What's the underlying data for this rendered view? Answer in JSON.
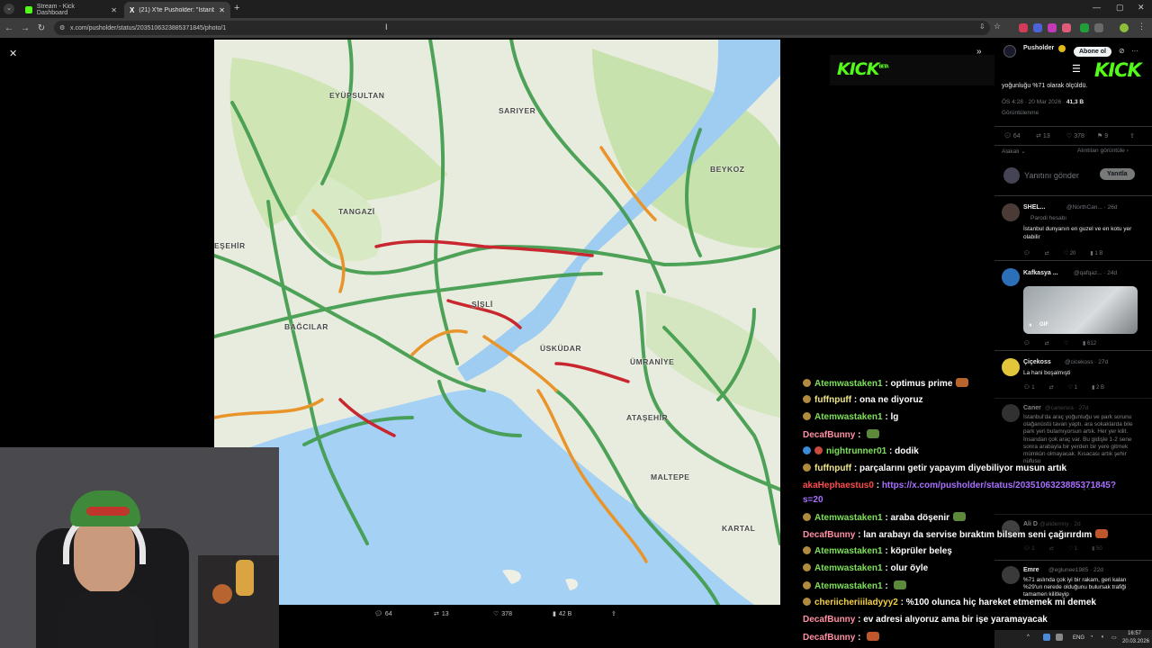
{
  "browser": {
    "tabs": [
      {
        "title": "Stream - Kick Dashboard",
        "active": false
      },
      {
        "title": "(21) X'te Pusholder: \"İstanbul'd",
        "active": true
      }
    ],
    "url": "x.com/pusholder/status/2035106323885371845/photo/1"
  },
  "map": {
    "places": [
      "EYÜPSULTAN",
      "SARIYER",
      "BEYKOZ",
      "TANGAZİ",
      "EŞEHİR",
      "BAĞCILAR",
      "ŞİŞLİ",
      "ÜSKÜDAR",
      "ÜMRANİYE",
      "ATAŞEHİR",
      "MALTEPE",
      "KARTAL"
    ]
  },
  "tweet_actions": {
    "replies": "64",
    "reposts": "13",
    "likes": "378",
    "views": "42 B"
  },
  "xpanel": {
    "author": "Pusholder",
    "follow_label": "Abone ol",
    "tweet_tail": "yoğunluğu %71 olarak ölçüldü.",
    "meta_time": "ÖS 4:28 · 20 Mar 2026 · ",
    "meta_views": "41,3 B",
    "meta_views_label": "Görüntülenme",
    "stats": {
      "replies": "64",
      "reposts": "13",
      "likes": "378",
      "bookmarks": "9"
    },
    "sort_label": "Alakalı",
    "quotes_label": "Alıntıları görüntüle",
    "reply_placeholder": "Yanıtını gönder",
    "reply_button": "Yanıtla",
    "replies": [
      {
        "name": "SHEL...",
        "handle": "@NorthCan... · 26d",
        "sub": "Parodi hesabı",
        "text": "İstanbul dunyanın en guzel ve en kotu yer olabilir",
        "stats": [
          "",
          "",
          "20",
          "1 B"
        ]
      },
      {
        "name": "Kafkasya ...",
        "handle": "@qafqaz... · 24d",
        "sub": "",
        "text": "",
        "gif": "GIF",
        "stats": [
          "",
          "",
          "",
          "612"
        ]
      },
      {
        "name": "Çiçekoss",
        "handle": "@cicekoss · 27d",
        "sub": "",
        "text": "La hani boşalmışti",
        "stats": [
          "1",
          "",
          "1",
          "2 B"
        ]
      },
      {
        "name": "Caner",
        "handle": "@canersra · 27d",
        "sub": "",
        "text": "İstanbul'da araç yoğunluğu ve park sorunu olağanüstü tavan yaptı. ara sokaklarda bile park yeri bulamıyorsun artık. Her yer kilit. İnsandan çok araç var. Bu gidişle 1-2 sene sonra arabayla bir yerden bir yere gitmek mümkün olmayacak. Kısacası artık şehir nüfusu",
        "stats": [
          "",
          "",
          "",
          "1 B"
        ]
      },
      {
        "name": "Ali D",
        "handle": "@alidemny · 2d",
        "sub": "",
        "text": "",
        "stats": [
          "1",
          "",
          "1",
          "50"
        ]
      },
      {
        "name": "Emre",
        "handle": "@eglunee1985 · 22d",
        "sub": "",
        "text": "%71 aslında çok iyi bir rakam, geri kalan %29'un nerede olduğunu bulursak trafiği tamamen kilitleyip",
        "stats": [
          "",
          "",
          "",
          ""
        ]
      }
    ]
  },
  "kick": {
    "logo": "KICK",
    "beta": "BETA"
  },
  "chat": [
    {
      "user": "Atemwastaken1",
      "color": "#7ee05a",
      "text": "optimus prime",
      "emote": true
    },
    {
      "user": "fuffnpuff",
      "color": "#f0e68c",
      "text": "ona ne diyoruz",
      "emote": false
    },
    {
      "user": "Atemwastaken1",
      "color": "#7ee05a",
      "text": "lg",
      "emote": false
    },
    {
      "user": "DecafBunny",
      "color": "#ff8fa3",
      "text": "",
      "emote": true
    },
    {
      "user": "nightrunner01",
      "color": "#7ee05a",
      "text": "dodik",
      "emote": false
    },
    {
      "user": "fuffnpuff",
      "color": "#f0e68c",
      "text": "parçalarını getir yapayım diyebiliyor musun artık",
      "emote": false
    },
    {
      "user": "akaHephaestus0",
      "color": "#ff4d4d",
      "text": "https://x.com/pusholder/status/2035106323885371845?",
      "cont": "s=20",
      "link": true
    },
    {
      "user": "Atemwastaken1",
      "color": "#7ee05a",
      "text": "araba döşenir",
      "emote": true
    },
    {
      "user": "DecafBunny",
      "color": "#ff8fa3",
      "text": "lan arabayı da servise bıraktım bilsem seni çağırırdım",
      "emote": true
    },
    {
      "user": "Atemwastaken1",
      "color": "#7ee05a",
      "text": "köprüler beleş",
      "emote": false
    },
    {
      "user": "Atemwastaken1",
      "color": "#7ee05a",
      "text": "olur öyle",
      "emote": false
    },
    {
      "user": "Atemwastaken1",
      "color": "#7ee05a",
      "text": "",
      "emote": true
    },
    {
      "user": "cheriicheriiiladyyy2",
      "color": "#f5d142",
      "text": "%100 olunca hiç hareket etmemek mi demek",
      "emote": false
    },
    {
      "user": "DecafBunny",
      "color": "#ff8fa3",
      "text": "ev adresi alıyoruz ama bir işe yaramayacak",
      "emote": false
    },
    {
      "user": "DecafBunny",
      "color": "#ff8fa3",
      "text": "",
      "emote": true
    }
  ],
  "taskbar": {
    "lang": "ENG",
    "time": "16:57",
    "date": "20.03.2026"
  }
}
